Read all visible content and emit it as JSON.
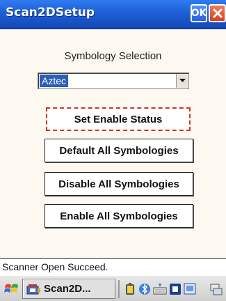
{
  "window": {
    "title": "Scan2DSetup",
    "ok_label": "OK"
  },
  "symbology": {
    "label": "Symbology Selection",
    "selected": "Aztec"
  },
  "buttons": {
    "set_enable": "Set Enable Status",
    "default_all": "Default All Symbologies",
    "disable_all": "Disable All Symbologies",
    "enable_all": "Enable All Symbologies"
  },
  "status": {
    "text": "Scanner Open Succeed."
  },
  "taskbar": {
    "task_label": "Scan2D...",
    "icons": [
      "start-icon",
      "app-icon",
      "battery-icon",
      "bluetooth-icon",
      "keyboard-icon",
      "input-panel-icon",
      "network-icon",
      "connection-icon"
    ]
  },
  "colors": {
    "titlebar": "#1f5fd6",
    "close": "#d3411f",
    "selection": "#2b5fb5",
    "focus_border": "#d8312a"
  }
}
